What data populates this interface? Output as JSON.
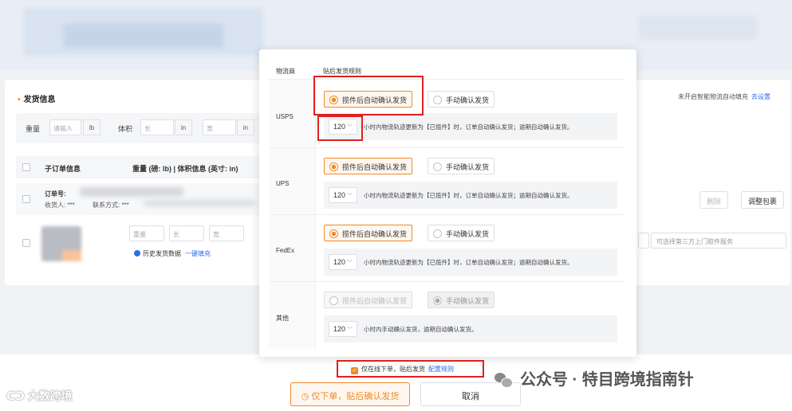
{
  "background": {
    "section_title": "发货信息",
    "right_note": "未开启智能物流自动填充",
    "right_note_link": "去设置",
    "weight_label": "重量",
    "weight_placeholder": "请输入",
    "weight_unit": "lb",
    "volume_label": "体积",
    "length_placeholder": "长",
    "width_placeholder": "宽",
    "dim_unit": "in",
    "table_sub_order": "子订单信息",
    "table_weight_info": "重量 (磅: lb) | 体积信息 (英寸: in)",
    "order_no_label": "订单号:",
    "recipient_label": "收货人: ***",
    "contact_label": "联系方式: ***",
    "delete_button": "删除",
    "adjust_package_button": "调整包裹",
    "item_weight_placeholder": "重量",
    "item_length_placeholder": "长",
    "item_width_placeholder": "宽",
    "history_label": "历史发货数据",
    "one_click_fill": "一键填充",
    "pickup_service_placeholder": "可选择第三方上门取件服务"
  },
  "modal": {
    "col_carrier": "物流商",
    "col_rule": "贴后发货规则",
    "auto_label": "揽件后自动确认发货",
    "manual_label": "手动确认发货",
    "rows": [
      {
        "carrier": "USPS",
        "hours": "120",
        "text": "小时内物流轨迹更新为【已揽件】时，订单自动确认发货；逾期自动确认发货。"
      },
      {
        "carrier": "UPS",
        "hours": "120",
        "text": "小时内物流轨迹更新为【已揽件】时，订单自动确认发货；逾期自动确认发货。"
      },
      {
        "carrier": "FedEx",
        "hours": "120",
        "text": "小时内物流轨迹更新为【已揽件】时，订单自动确认发货；逾期自动确认发货。"
      },
      {
        "carrier": "其他",
        "hours": "120",
        "text": "小时内手动确认发货，逾期自动确认发货。"
      }
    ]
  },
  "footer": {
    "sync_label": "仅在线下单，贴后发货",
    "config_rule_link": "配置规则",
    "primary_button": "仅下单，贴后确认发货",
    "cancel_button": "取消"
  },
  "watermarks": {
    "left": "大数跨境",
    "right": "公众号 · 特目跨境指南针"
  },
  "colors": {
    "accent": "#f08a24",
    "link": "#2b6de6",
    "highlight": "#e02020"
  }
}
